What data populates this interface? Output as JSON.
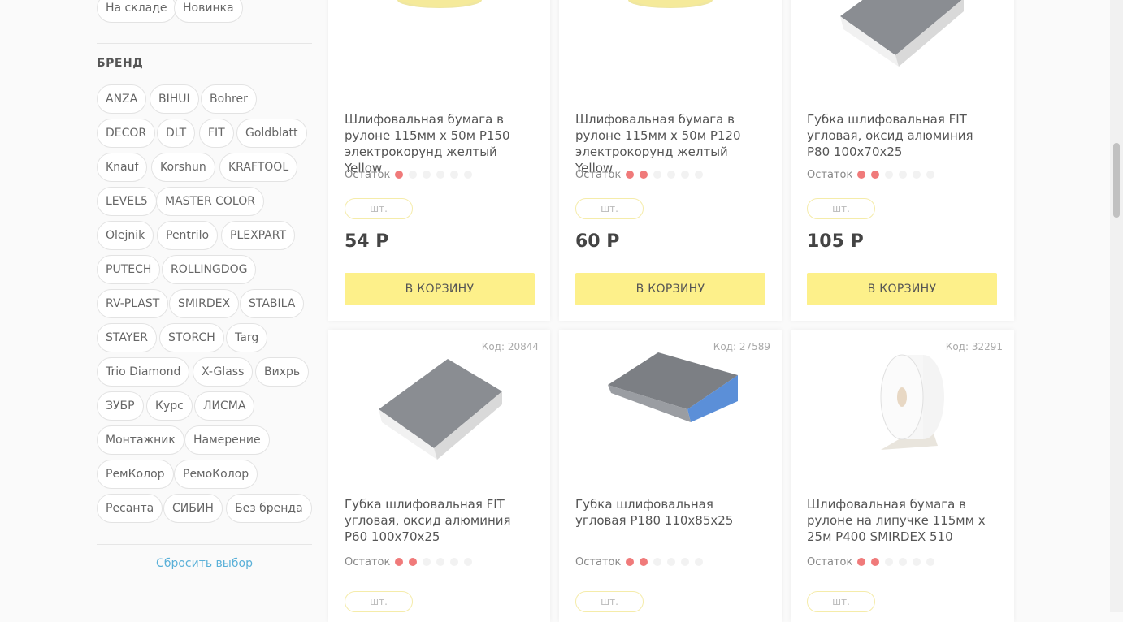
{
  "filters": {
    "top_chips": [
      "На складе",
      "Новинка"
    ],
    "brand_title": "БРЕНД",
    "brands": [
      "ANZA",
      "BIHUI",
      "Bohrer",
      "DECOR",
      "DLT",
      "FIT",
      "Goldblatt",
      "Knauf",
      "Korshun",
      "KRAFTOOL",
      "LEVEL5",
      "MASTER COLOR",
      "Olejnik",
      "Pentrilo",
      "PLEXPART",
      "PUTECH",
      "ROLLINGDOG",
      "RV-PLAST",
      "SMIRDEX",
      "STABILA",
      "STAYER",
      "STORCH",
      "Targ",
      "Trio Diamond",
      "X-Glass",
      "Вихрь",
      "ЗУБР",
      "Курс",
      "ЛИСМА",
      "Монтажник",
      "Намерение",
      "РемКолор",
      "РемоКолор",
      "Ресанта",
      "СИБИН",
      "Без бренда"
    ],
    "reset_label": "Сбросить выбор"
  },
  "products": [
    {
      "code": "",
      "title": "Шлифовальная бумага в рулоне 115мм х 50м P150 электрокорунд желтый Yellow",
      "stock_label": "Остаток",
      "stock_level": 1,
      "unit": "шт.",
      "price": "54 Р",
      "cart_label": "В КОРЗИНУ",
      "image": "yellow-roll"
    },
    {
      "code": "",
      "title": "Шлифовальная бумага в рулоне 115мм х 50м P120 электрокорунд желтый Yellow",
      "stock_label": "Остаток",
      "stock_level": 2,
      "unit": "шт.",
      "price": "60 Р",
      "cart_label": "В КОРЗИНУ",
      "image": "yellow-roll"
    },
    {
      "code": "",
      "title": "Губка шлифовальная FIT угловая, оксид алюминия P80 100х70х25",
      "stock_label": "Остаток",
      "stock_level": 2,
      "unit": "шт.",
      "price": "105 Р",
      "cart_label": "В КОРЗИНУ",
      "image": "grey-sponge"
    },
    {
      "code": "Код: 20844",
      "title": "Губка шлифовальная FIT угловая, оксид алюминия P60 100х70х25",
      "stock_label": "Остаток",
      "stock_level": 2,
      "unit": "шт.",
      "image": "grey-sponge"
    },
    {
      "code": "Код: 27589",
      "title": "Губка шлифовальная угловая Р180 110х85х25",
      "stock_label": "Остаток",
      "stock_level": 2,
      "unit": "шт.",
      "image": "blue-sponge"
    },
    {
      "code": "Код: 32291",
      "title": "Шлифовальная бумага в рулоне на липучке 115мм х 25м P400 SMIRDEX 510",
      "stock_label": "Остаток",
      "stock_level": 2,
      "unit": "шт.",
      "image": "white-roll"
    }
  ],
  "colors": {
    "accent": "#fdf08a",
    "stock_dot": "#f07a7a",
    "link": "#5ab0d8"
  }
}
